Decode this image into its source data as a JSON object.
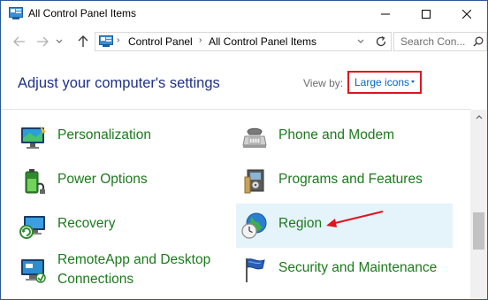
{
  "window": {
    "title": "All Control Panel Items",
    "icon": "control-panel-icon",
    "controls": [
      "minimize-icon",
      "maximize-icon",
      "close-icon"
    ]
  },
  "navigation": {
    "back_icon": "arrow-left-icon",
    "forward_icon": "arrow-right-icon",
    "recent_icon": "chevron-down-icon",
    "up_icon": "arrow-up-icon",
    "breadcrumb": [
      "Control Panel",
      "All Control Panel Items"
    ],
    "refresh_icon": "refresh-icon",
    "search_placeholder": "Search Con..."
  },
  "header": {
    "title": "Adjust your computer's settings",
    "view_by_label": "View by:",
    "view_by_value": "Large icons",
    "highlight_color": "#e0141e"
  },
  "items": {
    "left": [
      {
        "label": "Personalization",
        "icon": "personalization-icon"
      },
      {
        "label": "Power Options",
        "icon": "power-options-icon"
      },
      {
        "label": "Recovery",
        "icon": "recovery-icon"
      },
      {
        "label": "RemoteApp and Desktop Connections",
        "icon": "remoteapp-icon"
      }
    ],
    "right": [
      {
        "label": "Phone and Modem",
        "icon": "phone-modem-icon"
      },
      {
        "label": "Programs and Features",
        "icon": "programs-features-icon"
      },
      {
        "label": "Region",
        "icon": "region-icon",
        "selected": true
      },
      {
        "label": "Security and Maintenance",
        "icon": "security-maintenance-icon"
      }
    ]
  },
  "colors": {
    "title_blue": "#1e3287",
    "item_green": "#1c7a1c",
    "link_blue": "#0066cc",
    "selected_bg": "#e5f3fb",
    "arrow_red": "#e0141e"
  }
}
